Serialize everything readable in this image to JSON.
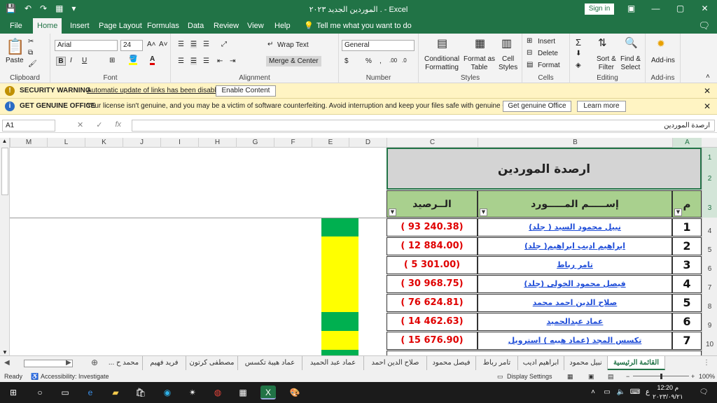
{
  "title": {
    "qat": [
      "💾",
      "↶",
      "↷",
      "▦",
      "▾"
    ],
    "document": "الموردين الجديد ٢٠٢٣ . - Excel",
    "sign_in": "Sign in",
    "buttons": [
      "▣",
      "—",
      "▢",
      "✕"
    ]
  },
  "tabs": [
    "File",
    "Home",
    "Insert",
    "Page Layout",
    "Formulas",
    "Data",
    "Review",
    "View",
    "Help"
  ],
  "tell_me": "Tell me what you want to do",
  "ribbon": {
    "clipboard": {
      "paste": "Paste",
      "label": "Clipboard"
    },
    "font": {
      "name": "Arial",
      "size": "24",
      "label": "Font",
      "bold": "B",
      "italic": "I",
      "underline": "U"
    },
    "alignment": {
      "wrap": "Wrap Text",
      "merge": "Merge & Center",
      "label": "Alignment"
    },
    "number": {
      "format": "General",
      "label": "Number",
      "currency": "$",
      "percent": "%",
      "comma": ","
    },
    "styles": {
      "cond": "Conditional",
      "cond2": "Formatting",
      "format_as": "Format as",
      "table": "Table",
      "cell": "Cell",
      "styles": "Styles",
      "label": "Styles"
    },
    "cells": {
      "insert": "Insert",
      "delete": "Delete",
      "format": "Format",
      "label": "Cells"
    },
    "editing": {
      "sort": "Sort &",
      "filter": "Filter",
      "find": "Find &",
      "select": "Select",
      "label": "Editing"
    },
    "addins": {
      "name": "Add-ins",
      "label": "Add-ins"
    }
  },
  "security": {
    "title": "SECURITY WARNING",
    "text": "Automatic update of links has been disabled",
    "button": "Enable Content"
  },
  "genuine": {
    "title": "GET GENUINE OFFICE",
    "text": "Your license isn't genuine, and you may be a victim of software counterfeiting. Avoid interruption and keep your files safe with genuine Office today.",
    "button1": "Get genuine Office",
    "button2": "Learn more"
  },
  "formula_bar": {
    "name_box": "A1",
    "content": "ارصدة الموردين"
  },
  "columns": [
    "M",
    "L",
    "K",
    "J",
    "I",
    "H",
    "G",
    "F",
    "E",
    "D",
    "C",
    "B",
    "A"
  ],
  "rows": [
    "1",
    "2",
    "3",
    "4",
    "5",
    "6",
    "7",
    "8",
    "9",
    "10"
  ],
  "sheet": {
    "title": "ارصدة الموردين",
    "hdr_num": "م",
    "hdr_name": "إســـــم المـــــورد",
    "hdr_bal": "الــرصيد",
    "data": [
      {
        "n": "1",
        "name": "نبيل محمود السيد ( جلد)",
        "bal": "( 93 240.38)"
      },
      {
        "n": "2",
        "name": "ابراهيم اديب ابراهيم( جلد)",
        "bal": "( 12 884.00)"
      },
      {
        "n": "3",
        "name": "تامر رباط",
        "bal": "( 5 301.00)"
      },
      {
        "n": "4",
        "name": "فيصل محمود الخولى (جلد)",
        "bal": "( 30 968.75)"
      },
      {
        "n": "5",
        "name": "صلاح الدين احمد محمد",
        "bal": "( 76 624.81)"
      },
      {
        "n": "6",
        "name": "عماد عبدالحميد",
        "bal": "( 14 462.63)"
      },
      {
        "n": "7",
        "name": "تكسس المجد (عماد هيبه ) استرويل",
        "bal": "( 15 676.90)"
      }
    ]
  },
  "sheet_tabs": [
    "القائمة الرئيسية",
    "نبيل محمود",
    "ابراهيم اديب",
    "تامر رباط",
    "فيصل محمود",
    "صلاح الدين احمد",
    "عماد عبد الحميد",
    "عماد هيبة تكسس",
    "مصطفى كرتون",
    "فريد فهيم",
    "محمد ح ..."
  ],
  "status": {
    "ready": "Ready",
    "accessibility": "Accessibility: Investigate",
    "display": "Display Settings",
    "zoom": "100%"
  },
  "taskbar": {
    "time": "12:20 م",
    "date": "٢٠٢٣/٠٩/٢١",
    "lang": "ع"
  },
  "colors": {
    "excel_green": "#217346",
    "header_green": "#a9d08e",
    "value_red": "#e00000",
    "name_blue": "#1f4dd8",
    "bar_green": "#00b050",
    "bar_yellow": "#ffff00"
  }
}
